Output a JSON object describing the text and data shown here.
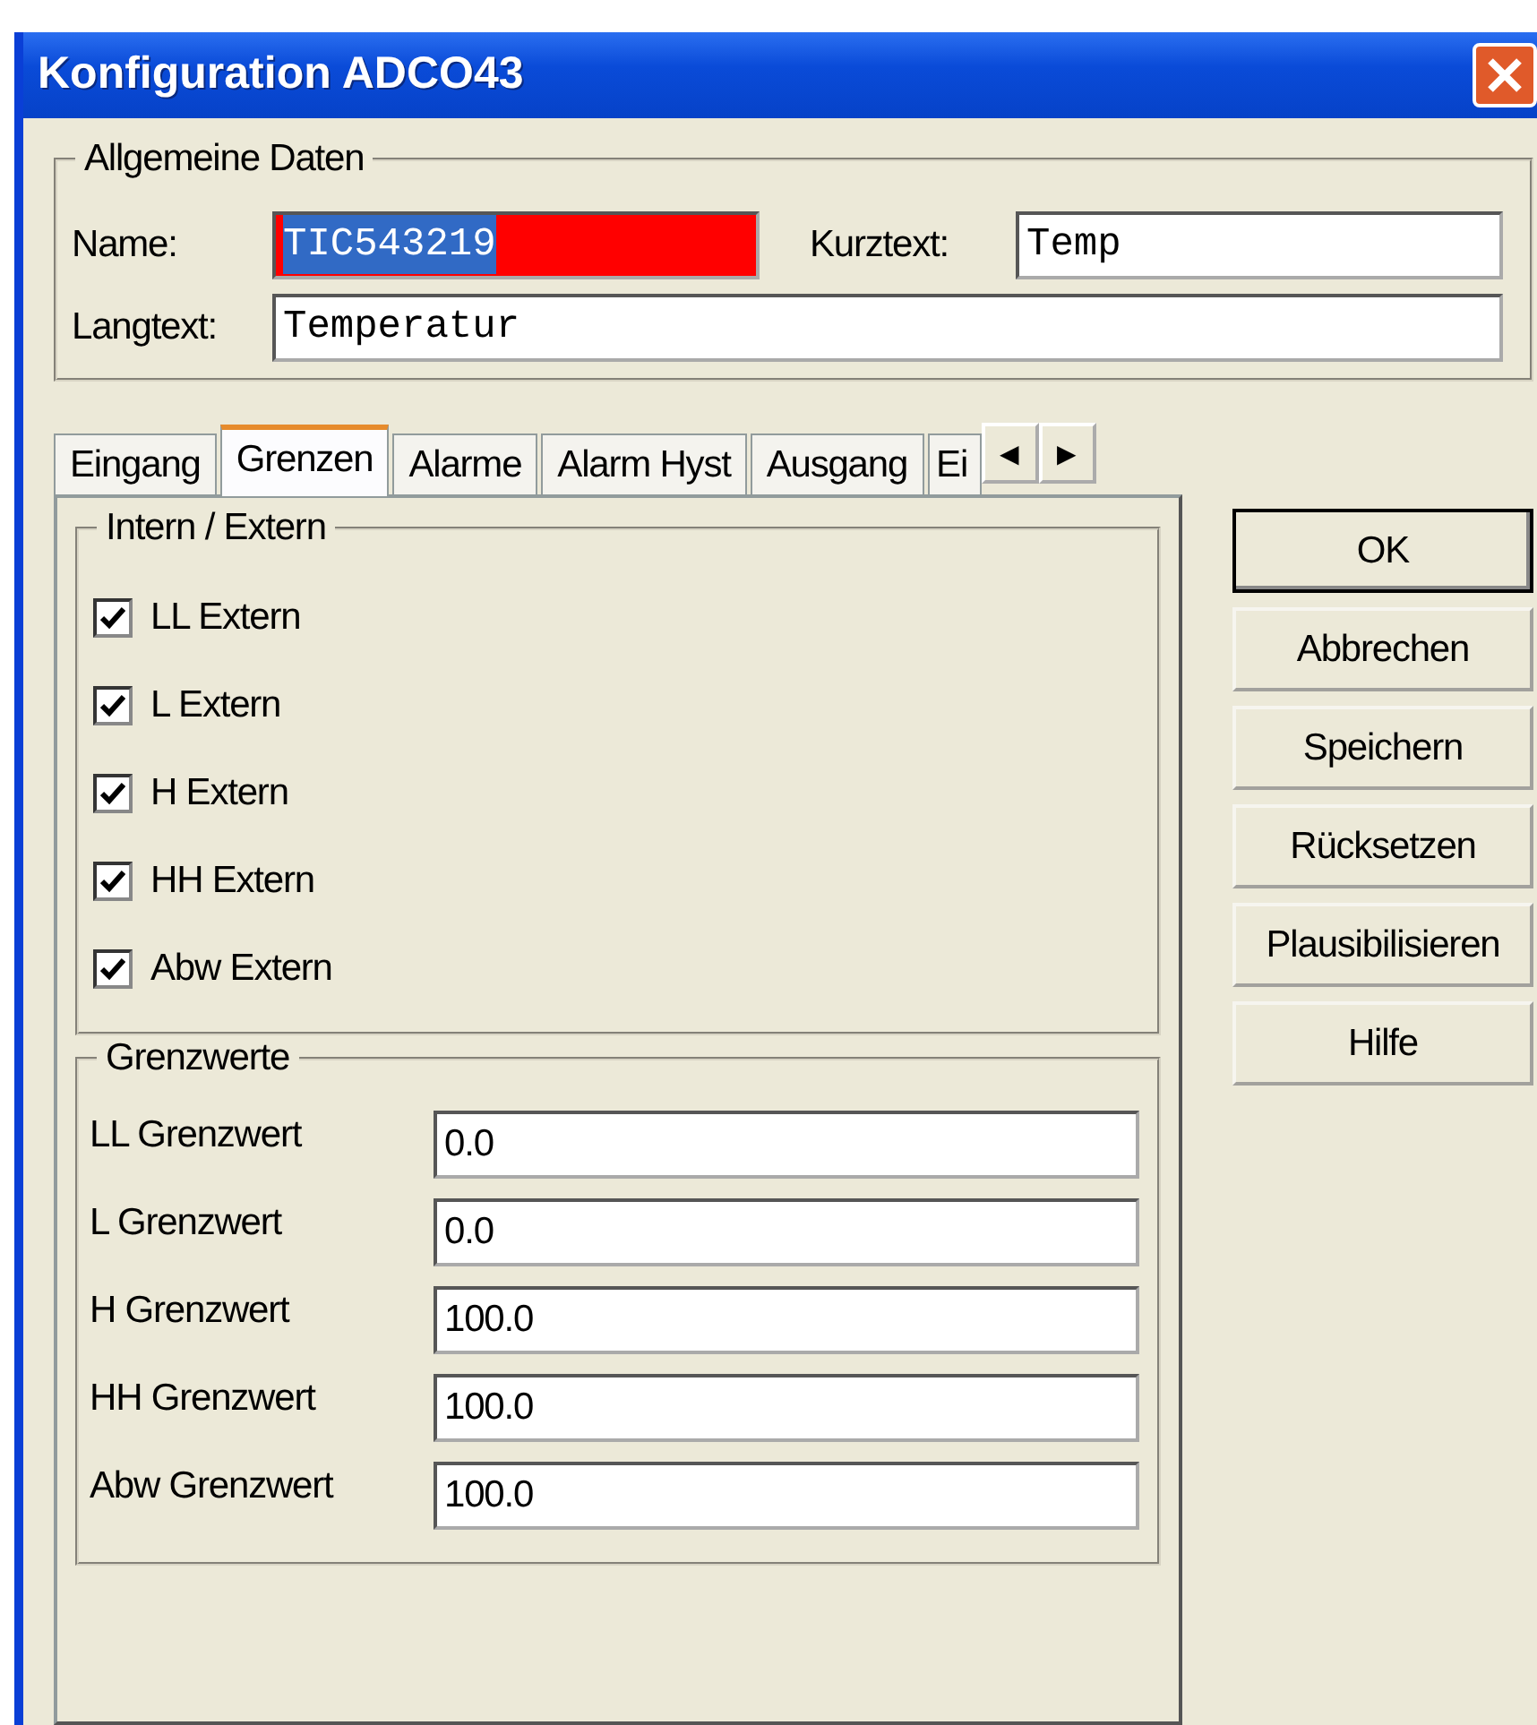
{
  "window": {
    "title": "Konfiguration ADCO43"
  },
  "general": {
    "legend": "Allgemeine Daten",
    "name": {
      "label": "Name:",
      "value": "TIC543219",
      "error": true,
      "text_selected": true
    },
    "short": {
      "label": "Kurztext:",
      "value": "Temp"
    },
    "long": {
      "label": "Langtext:",
      "value": "Temperatur"
    }
  },
  "tabs": [
    {
      "label": "Eingang",
      "selected": false
    },
    {
      "label": "Grenzen",
      "selected": true
    },
    {
      "label": "Alarme",
      "selected": false
    },
    {
      "label": "Alarm Hyst",
      "selected": false
    },
    {
      "label": "Ausgang",
      "selected": false
    },
    {
      "label": "Ei",
      "selected": false
    }
  ],
  "tab_scroll": [
    "◀",
    "▶"
  ],
  "intern_extern": {
    "legend": "Intern / Extern",
    "items": [
      {
        "label": "LL Extern",
        "checked": true
      },
      {
        "label": "L Extern",
        "checked": true
      },
      {
        "label": "H Extern",
        "checked": true
      },
      {
        "label": "HH Extern",
        "checked": true
      },
      {
        "label": "Abw Extern",
        "checked": true
      }
    ]
  },
  "limits": {
    "legend": "Grenzwerte",
    "items": [
      {
        "label": "LL Grenzwert",
        "value": "0.0"
      },
      {
        "label": "L Grenzwert",
        "value": "0.0"
      },
      {
        "label": "H Grenzwert",
        "value": "100.0"
      },
      {
        "label": "HH Grenzwert",
        "value": "100.0"
      },
      {
        "label": "Abw Grenzwert",
        "value": "100.0"
      }
    ]
  },
  "buttons": [
    {
      "label": "OK",
      "default": true
    },
    {
      "label": "Abbrechen",
      "default": false
    },
    {
      "label": "Speichern",
      "default": false
    },
    {
      "label": "Rücksetzen",
      "default": false
    },
    {
      "label": "Plausibilisieren",
      "default": false
    },
    {
      "label": "Hilfe",
      "default": false
    }
  ]
}
